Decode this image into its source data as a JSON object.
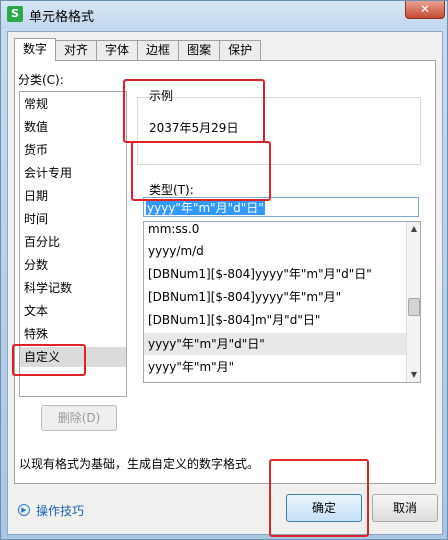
{
  "window": {
    "title": "单元格格式",
    "app_icon": "S",
    "close_label": "✕"
  },
  "tabs": [
    {
      "label": "数字",
      "active": true
    },
    {
      "label": "对齐",
      "active": false
    },
    {
      "label": "字体",
      "active": false
    },
    {
      "label": "边框",
      "active": false
    },
    {
      "label": "图案",
      "active": false
    },
    {
      "label": "保护",
      "active": false
    }
  ],
  "category": {
    "label": "分类(C):",
    "items": [
      "常规",
      "数值",
      "货币",
      "会计专用",
      "日期",
      "时间",
      "百分比",
      "分数",
      "科学记数",
      "文本",
      "特殊",
      "自定义"
    ],
    "selected": "自定义"
  },
  "sample": {
    "label": "示例",
    "value": "2037年5月29日"
  },
  "type": {
    "label": "类型(T):",
    "value": "yyyy\"年\"m\"月\"d\"日\""
  },
  "formats": {
    "items": [
      "mm:ss.0",
      "yyyy/m/d",
      "[DBNum1][$-804]yyyy\"年\"m\"月\"d\"日\"",
      "[DBNum1][$-804]yyyy\"年\"m\"月\"",
      "[DBNum1][$-804]m\"月\"d\"日\"",
      "yyyy\"年\"m\"月\"d\"日\"",
      "yyyy\"年\"m\"月\""
    ],
    "selected": "yyyy\"年\"m\"月\"d\"日\""
  },
  "buttons": {
    "delete": "删除(D)",
    "ok": "确定",
    "cancel": "取消"
  },
  "description": "以现有格式为基础，生成自定义的数字格式。",
  "help_link": "操作技巧",
  "colors": {
    "highlight": "#e0232a",
    "selection": "#3399ff"
  }
}
